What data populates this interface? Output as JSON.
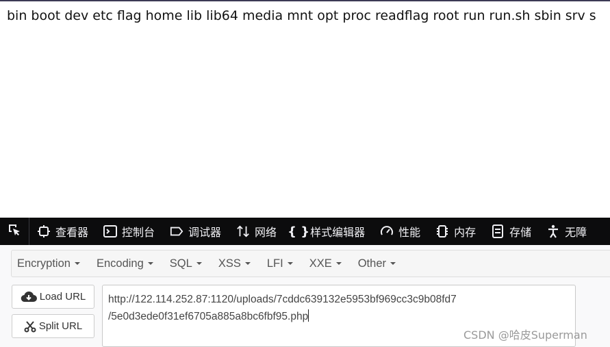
{
  "page": {
    "output_text": "bin boot dev etc flag home lib lib64 media mnt opt proc readflag root run run.sh sbin srv s"
  },
  "devtools": {
    "tabs": [
      {
        "label": "查看器",
        "icon": "inspector-icon"
      },
      {
        "label": "控制台",
        "icon": "console-icon"
      },
      {
        "label": "调试器",
        "icon": "debugger-icon"
      },
      {
        "label": "网络",
        "icon": "network-icon"
      },
      {
        "label": "样式编辑器",
        "icon": "style-editor-icon"
      },
      {
        "label": "性能",
        "icon": "performance-icon"
      },
      {
        "label": "内存",
        "icon": "memory-icon"
      },
      {
        "label": "存储",
        "icon": "storage-icon"
      },
      {
        "label": "无障",
        "icon": "accessibility-icon"
      }
    ]
  },
  "hackbar": {
    "menu": [
      "Encryption",
      "Encoding",
      "SQL",
      "XSS",
      "LFI",
      "XXE",
      "Other"
    ],
    "load_url_label": "Load URL",
    "split_url_label": "Split URL",
    "url_line1": "http://122.114.252.87:1120/uploads/7cddc639132e5953bf969cc3c9b08fd7",
    "url_line2": "/5e0d3ede0f31ef6705a885a8bc6fbf95.php"
  },
  "watermark": "CSDN @哈皮Superman",
  "colors": {
    "devtools_bar": "#0c0c0d",
    "devtools_text": "#f0f0f4",
    "menu_text": "#555555"
  }
}
